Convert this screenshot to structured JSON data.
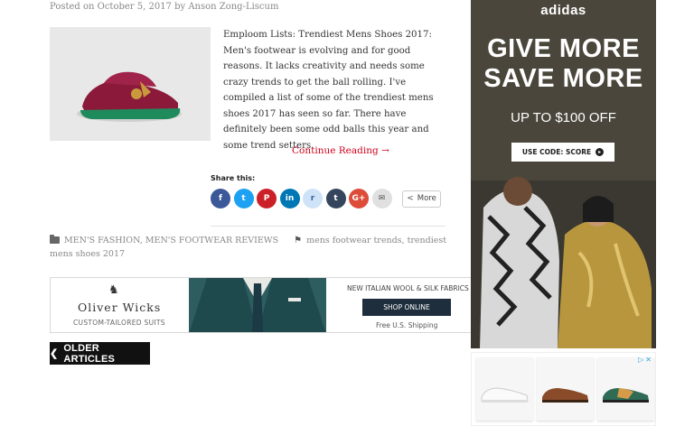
{
  "post": {
    "meta": "Posted on October 5, 2017 by Anson Zong-Liscum",
    "excerpt": "Emploom Lists: Trendiest Mens Shoes 2017: Men's footwear is evolving and for good reasons. It lacks creativity and needs some crazy trends to get the ball rolling. I've compiled a list of some of the trendiest mens shoes 2017 has seen so far. There have definitely been some odd balls this year and some trend setters.",
    "continue": "Continue Reading →"
  },
  "share": {
    "label": "Share this:",
    "buttons": [
      {
        "name": "facebook",
        "glyph": "f",
        "color": "#3b5998"
      },
      {
        "name": "twitter",
        "glyph": "t",
        "color": "#1da1f2"
      },
      {
        "name": "pinterest",
        "glyph": "P",
        "color": "#cb2027"
      },
      {
        "name": "linkedin",
        "glyph": "in",
        "color": "#0077b5"
      },
      {
        "name": "reddit",
        "glyph": "r",
        "color": "#cee3f8"
      },
      {
        "name": "tumblr",
        "glyph": "t",
        "color": "#35465c"
      },
      {
        "name": "google-plus",
        "glyph": "G+",
        "color": "#dd4b39"
      },
      {
        "name": "email",
        "glyph": "✉",
        "color": "#e0e0e0"
      }
    ],
    "more": "More"
  },
  "tags": {
    "categories": "MEN'S FASHION, MEN'S FOOTWEAR REVIEWS",
    "tags": "mens footwear trends, trendiest mens shoes 2017"
  },
  "banner": {
    "brand": "Oliver Wicks",
    "sub": "CUSTOM-TAILORED SUITS",
    "headline": "NEW ITALIAN WOOL & SILK FABRICS",
    "cta": "SHOP ONLINE",
    "shipping": "Free U.S. Shipping"
  },
  "pagination": {
    "older": "OLDER ARTICLES"
  },
  "sidebar_ad": {
    "brand": "adidas",
    "line1": "GIVE MORE",
    "line2": "SAVE MORE",
    "offer": "UP TO $100 OFF",
    "code": "USE CODE: SCORE"
  },
  "colors": {
    "accent_red": "#d0021b",
    "dark_button": "#111111",
    "ad_navy": "#1e2e3d"
  }
}
